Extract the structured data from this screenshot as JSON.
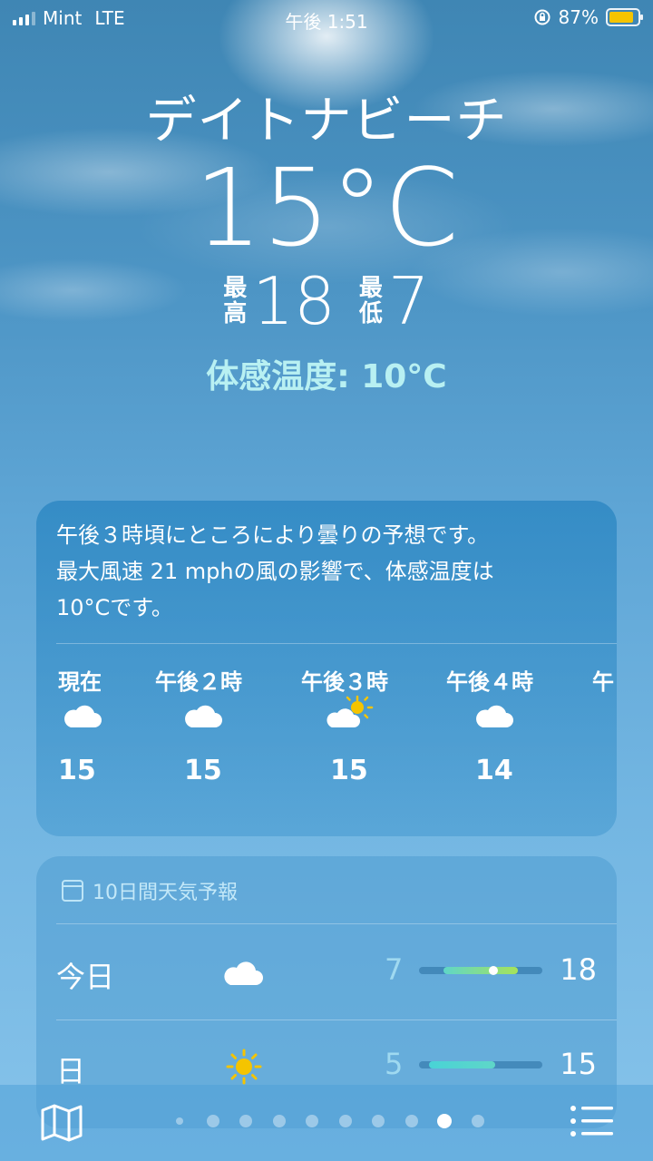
{
  "status": {
    "carrier": "Mint",
    "network": "LTE",
    "time": "午後 1:51",
    "battery": "87%",
    "battery_level": 0.87
  },
  "location": {
    "city": "デイトナビーチ",
    "temperature": "15°C",
    "high_label_1": "最",
    "high_label_2": "高",
    "high": "18",
    "low_label_1": "最",
    "low_label_2": "低",
    "low": "7",
    "feels_like": "体感温度: 10°C"
  },
  "hourly": {
    "summary": [
      "午後３時頃にところにより曇りの予想です。",
      "最大風速 21 mphの風の影響で、体感温度は",
      "10°Cです。"
    ],
    "items": [
      {
        "time": "現在",
        "icon": "cloud-icon",
        "temp": "15"
      },
      {
        "time": "午後２時",
        "icon": "cloud-icon",
        "temp": "15"
      },
      {
        "time": "午後３時",
        "icon": "sun-cloud-icon",
        "temp": "15"
      },
      {
        "time": "午後４時",
        "icon": "cloud-icon",
        "temp": "14"
      },
      {
        "time": "午",
        "icon": "",
        "temp": ""
      }
    ]
  },
  "ten_day": {
    "title": "10日間天気予報",
    "rows": [
      {
        "day": "今日",
        "icon": "cloud-icon",
        "low": "7",
        "high": "18",
        "range_start": 0.2,
        "range_end": 0.8,
        "current": 0.6,
        "colors": [
          "#5fd6c8",
          "#a6e35a"
        ]
      },
      {
        "day": "日",
        "icon": "sun-icon",
        "low": "5",
        "high": "15",
        "range_start": 0.08,
        "range_end": 0.62,
        "current": null,
        "colors": [
          "#49d3d6",
          "#5fd6c8"
        ]
      }
    ]
  },
  "tabbar": {
    "pages": 10,
    "active_page": 9
  },
  "colors": {
    "feels": "#b8f0f2",
    "sun": "#f5c400",
    "battery": "#f5c400"
  }
}
